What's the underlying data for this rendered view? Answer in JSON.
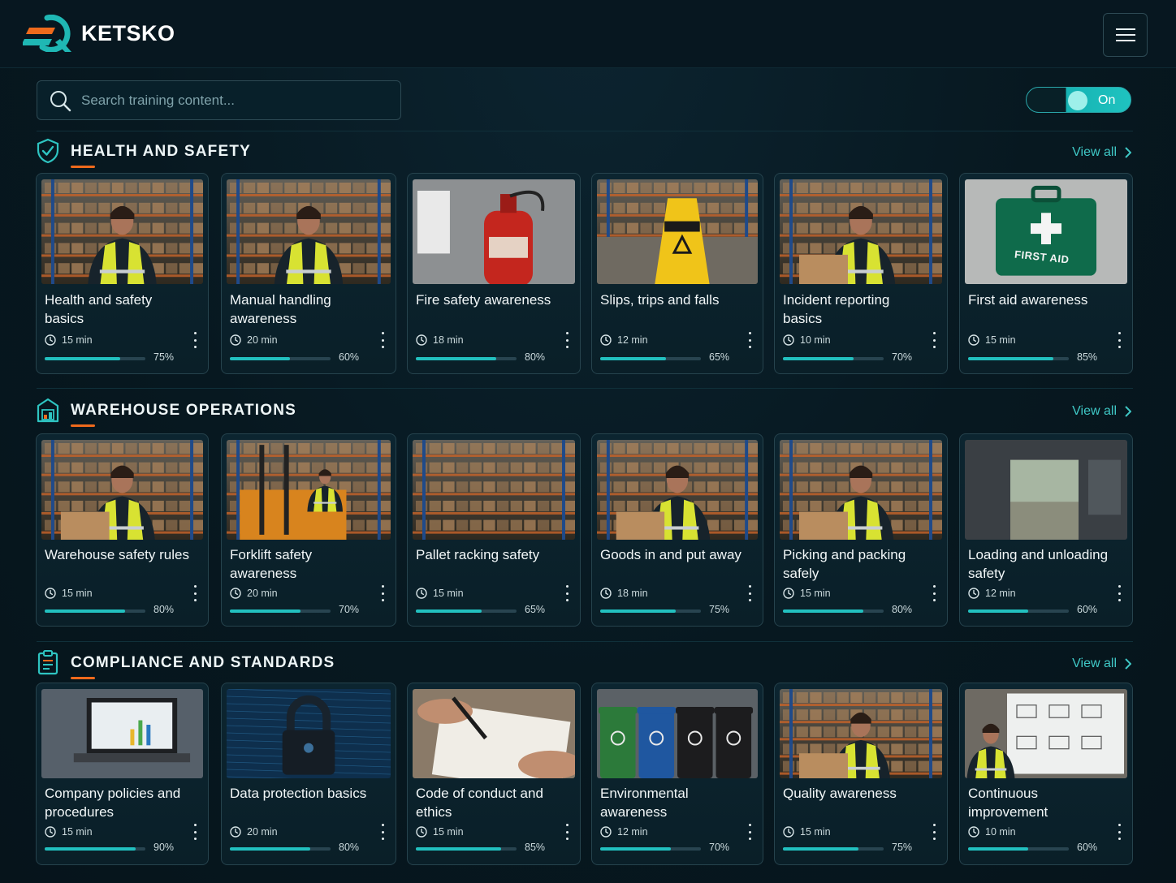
{
  "brand": {
    "name": "KETSKO"
  },
  "search": {
    "placeholder": "Search training content..."
  },
  "toggle": {
    "label": "On",
    "state": true
  },
  "colors": {
    "accent": "#22c0bf",
    "underline": "#ef6a1c",
    "background": "#071820"
  },
  "sections": [
    {
      "title": "HEALTH AND SAFETY",
      "icon": "shield-check-icon",
      "view_all": "View all",
      "cards": [
        {
          "title": "Health and safety basics",
          "duration": "15 min",
          "progress_label": "75%",
          "progress": 0.75,
          "image": "worker-portrait-photo"
        },
        {
          "title": "Manual handling awareness",
          "duration": "20 min",
          "progress_label": "60%",
          "progress": 0.6,
          "image": "warehouse-aisle-worker-photo"
        },
        {
          "title": "Fire safety awareness",
          "duration": "18 min",
          "progress_label": "80%",
          "progress": 0.8,
          "image": "fire-extinguisher-photo"
        },
        {
          "title": "Slips, trips and falls",
          "duration": "12 min",
          "progress_label": "65%",
          "progress": 0.65,
          "image": "wet-floor-sign-photo"
        },
        {
          "title": "Incident reporting basics",
          "duration": "10 min",
          "progress_label": "70%",
          "progress": 0.7,
          "image": "worker-writing-report-photo"
        },
        {
          "title": "First aid awareness",
          "duration": "15 min",
          "progress_label": "85%",
          "progress": 0.85,
          "image": "first-aid-kit-photo",
          "image_text": "FIRST AID"
        }
      ]
    },
    {
      "title": "WAREHOUSE OPERATIONS",
      "icon": "warehouse-icon",
      "view_all": "View all",
      "cards": [
        {
          "title": "Warehouse safety rules",
          "duration": "15 min",
          "progress_label": "80%",
          "progress": 0.8,
          "image": "worker-with-tablet-photo"
        },
        {
          "title": "Forklift safety awareness",
          "duration": "20 min",
          "progress_label": "70%",
          "progress": 0.7,
          "image": "forklift-photo"
        },
        {
          "title": "Pallet racking safety",
          "duration": "15 min",
          "progress_label": "65%",
          "progress": 0.65,
          "image": "pallet-racking-photo"
        },
        {
          "title": "Goods in and put away",
          "duration": "18 min",
          "progress_label": "75%",
          "progress": 0.75,
          "image": "worker-taping-box-photo"
        },
        {
          "title": "Picking and packing safely",
          "duration": "15 min",
          "progress_label": "80%",
          "progress": 0.8,
          "image": "worker-packing-box-photo"
        },
        {
          "title": "Loading and unloading safety",
          "duration": "12 min",
          "progress_label": "60%",
          "progress": 0.6,
          "image": "loading-dock-photo"
        }
      ]
    },
    {
      "title": "COMPLIANCE AND STANDARDS",
      "icon": "clipboard-icon",
      "view_all": "View all",
      "cards": [
        {
          "title": "Company policies and procedures",
          "duration": "15 min",
          "progress_label": "90%",
          "progress": 0.9,
          "image": "laptop-dashboard-photo"
        },
        {
          "title": "Data protection basics",
          "duration": "20 min",
          "progress_label": "80%",
          "progress": 0.8,
          "image": "padlock-circuit-photo"
        },
        {
          "title": "Code of conduct and ethics",
          "duration": "15 min",
          "progress_label": "85%",
          "progress": 0.85,
          "image": "signing-document-photo"
        },
        {
          "title": "Environmental awareness",
          "duration": "12 min",
          "progress_label": "70%",
          "progress": 0.7,
          "image": "recycling-bins-photo"
        },
        {
          "title": "Quality awareness",
          "duration": "15 min",
          "progress_label": "75%",
          "progress": 0.75,
          "image": "worker-inspecting-tablet-photo"
        },
        {
          "title": "Continuous improvement",
          "duration": "10 min",
          "progress_label": "60%",
          "progress": 0.6,
          "image": "whiteboard-process-photo"
        }
      ]
    }
  ]
}
